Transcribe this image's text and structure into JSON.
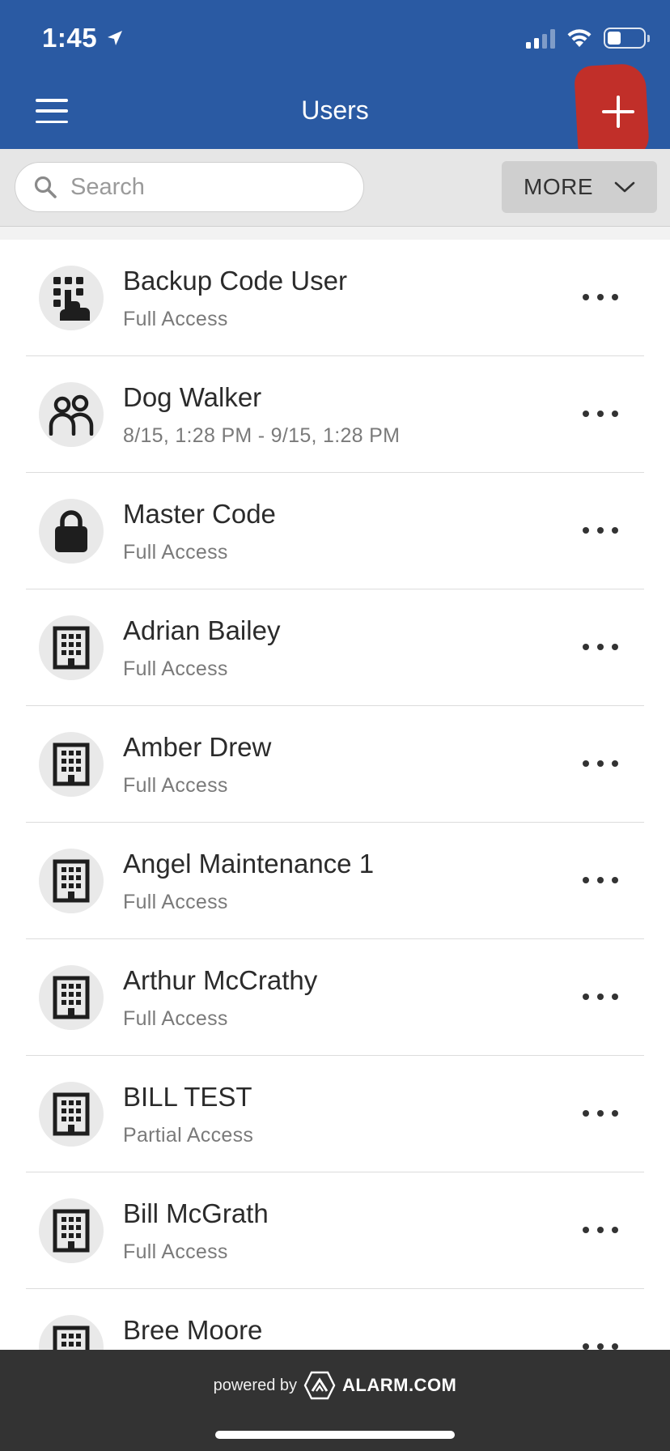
{
  "status_bar": {
    "time": "1:45",
    "icons": [
      "location-arrow-icon",
      "cellular-signal-icon",
      "wifi-icon",
      "battery-icon"
    ]
  },
  "header": {
    "title": "Users",
    "menu_icon": "hamburger-menu-icon",
    "add_icon": "plus-icon",
    "background_color": "#2a5aa3"
  },
  "toolbar": {
    "search_placeholder": "Search",
    "search_value": "",
    "more_label": "MORE"
  },
  "users": [
    {
      "name": "Backup Code User",
      "access": "Full Access",
      "icon": "keypad-hand-icon"
    },
    {
      "name": "Dog Walker",
      "access": "8/15, 1:28 PM - 9/15, 1:28 PM",
      "icon": "people-icon"
    },
    {
      "name": "Master Code",
      "access": "Full Access",
      "icon": "lock-icon"
    },
    {
      "name": "Adrian Bailey",
      "access": "Full Access",
      "icon": "building-icon"
    },
    {
      "name": "Amber Drew",
      "access": "Full Access",
      "icon": "building-icon"
    },
    {
      "name": "Angel Maintenance 1",
      "access": "Full Access",
      "icon": "building-icon"
    },
    {
      "name": "Arthur McCrathy",
      "access": "Full Access",
      "icon": "building-icon"
    },
    {
      "name": "BILL TEST",
      "access": "Partial Access",
      "icon": "building-icon"
    },
    {
      "name": "Bill McGrath",
      "access": "Full Access",
      "icon": "building-icon"
    },
    {
      "name": "Bree Moore",
      "access": "",
      "icon": "building-icon"
    }
  ],
  "footer": {
    "powered_by": "powered by",
    "brand": "ALARM.COM"
  }
}
